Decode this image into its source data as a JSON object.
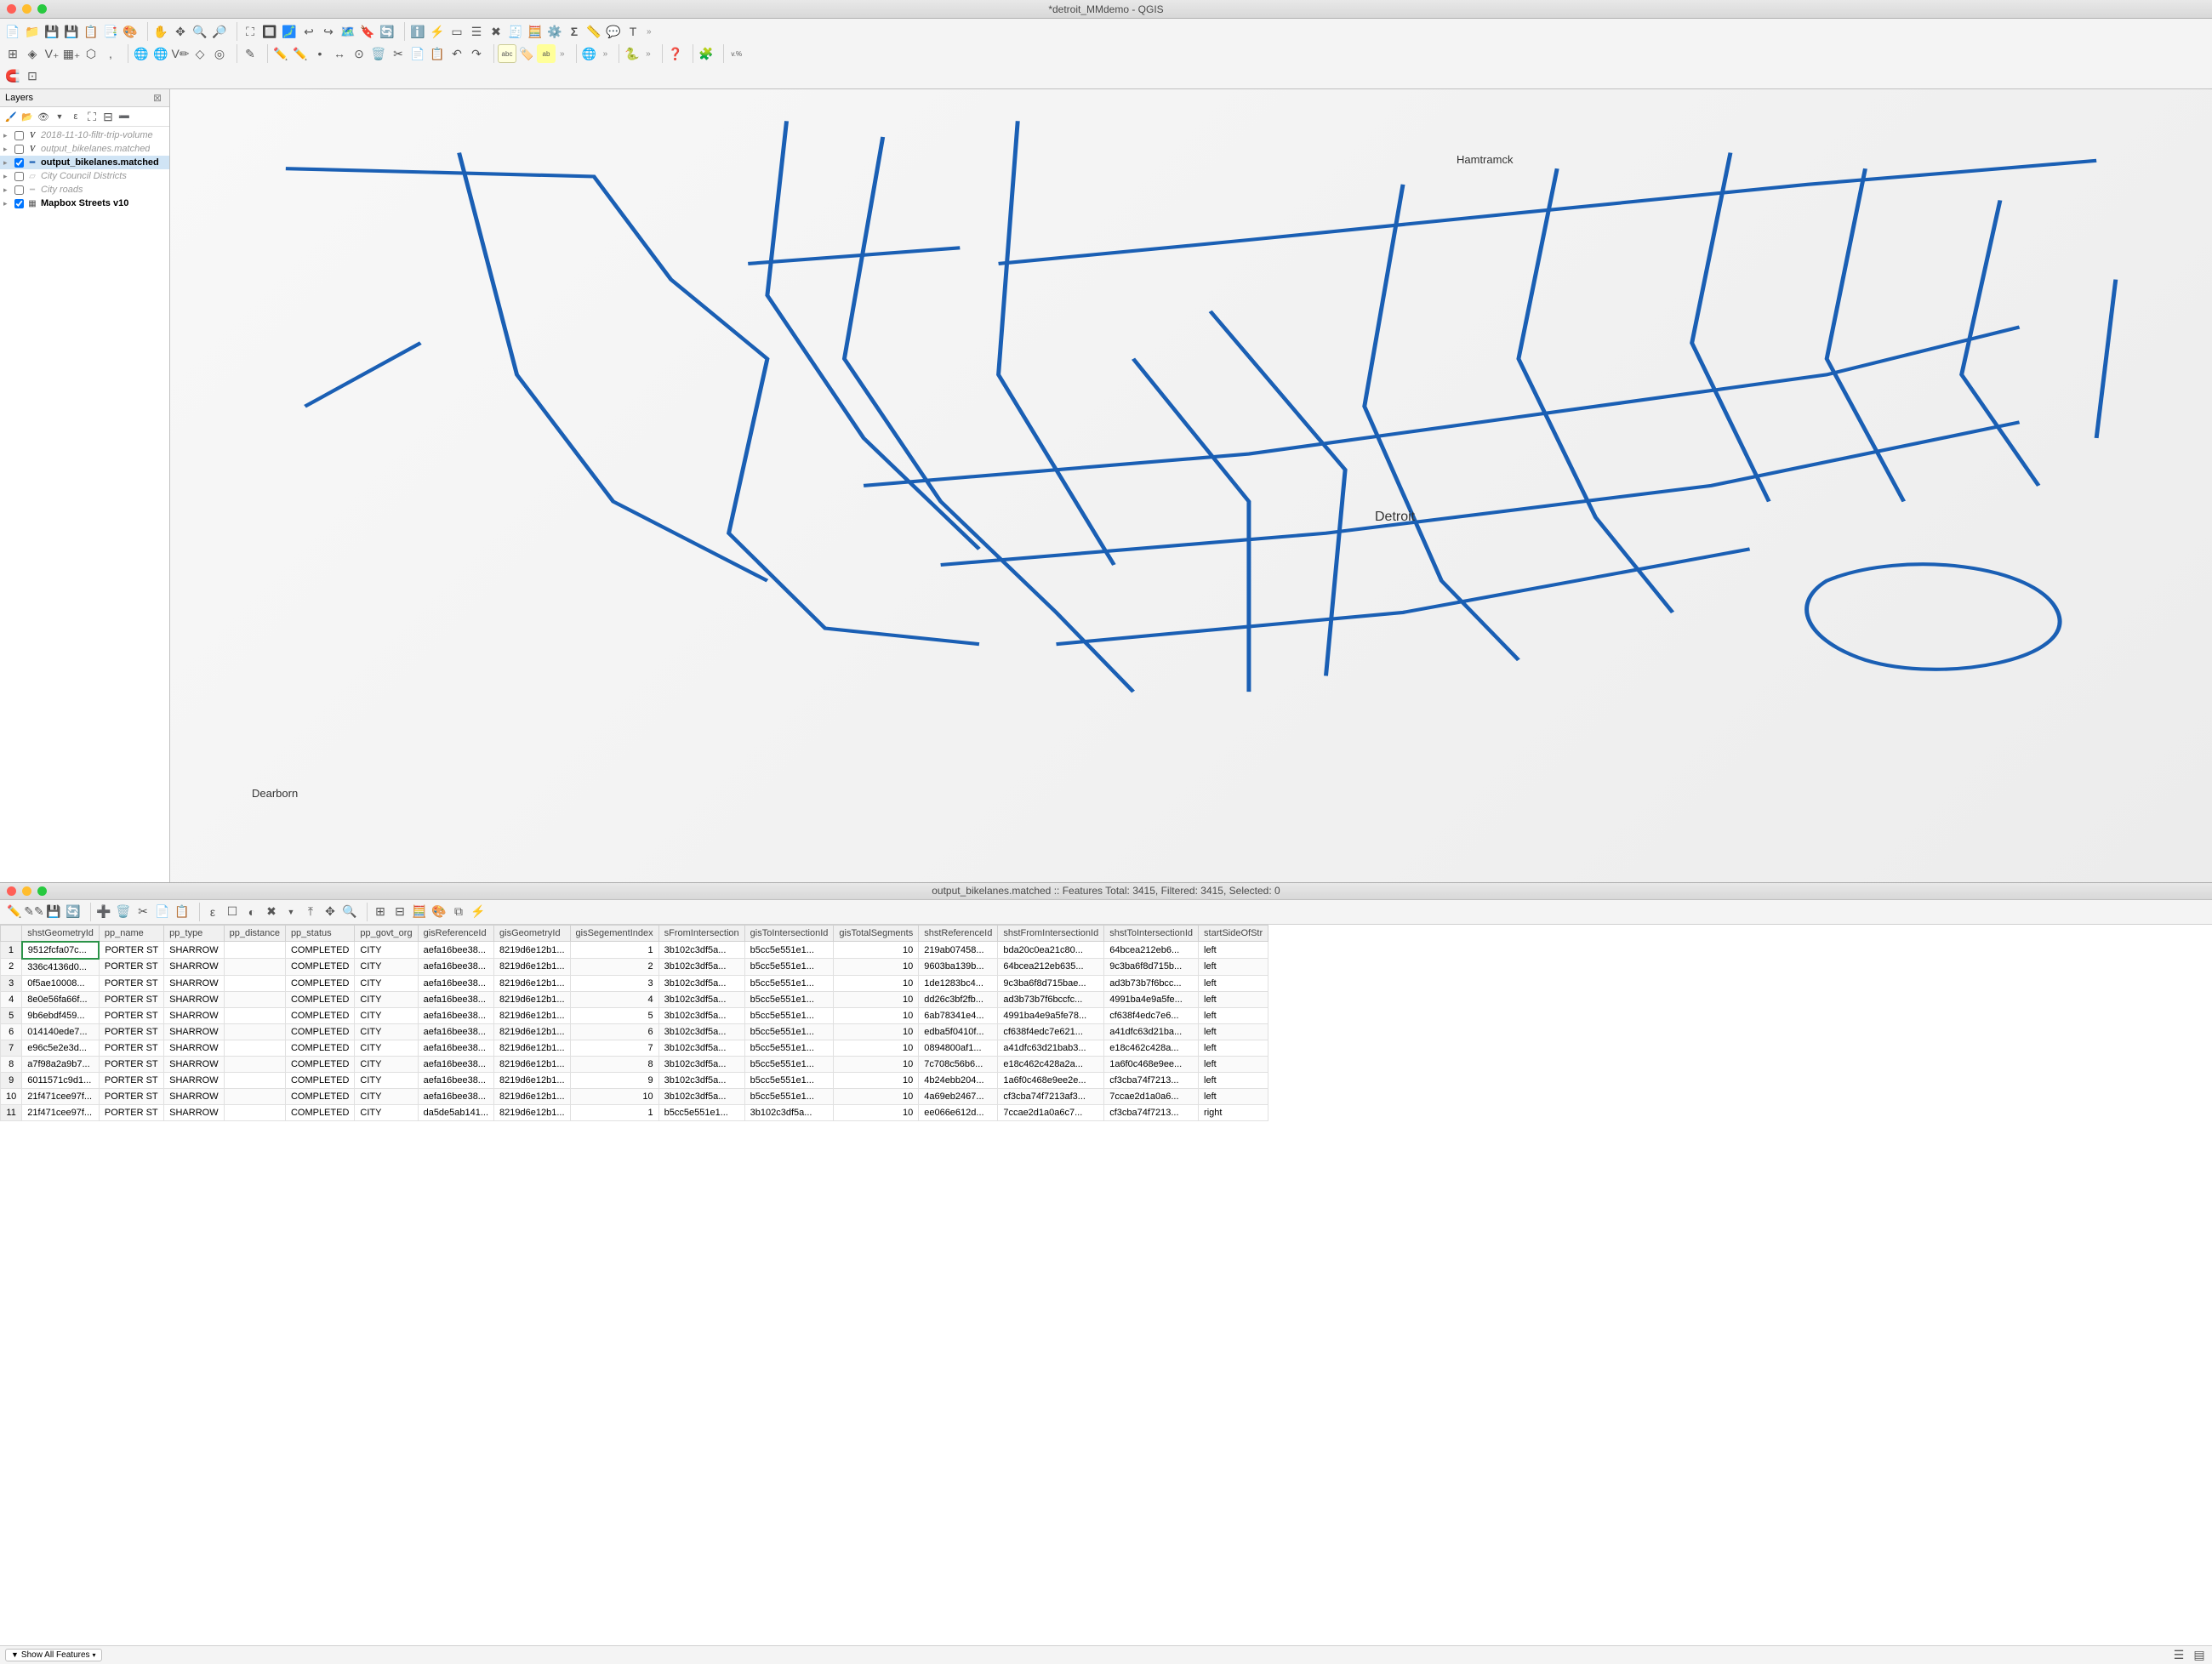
{
  "window": {
    "title": "*detroit_MMdemo - QGIS"
  },
  "layers_panel": {
    "title": "Layers",
    "items": [
      {
        "checked": false,
        "icon": "i-v",
        "name": "2018-11-10-filtr-trip-volume",
        "class": "italic"
      },
      {
        "checked": false,
        "icon": "i-v",
        "name": "output_bikelanes.matched",
        "class": "italic"
      },
      {
        "checked": true,
        "icon": "i-bike",
        "name": "output_bikelanes.matched",
        "class": "bold",
        "selected": true
      },
      {
        "checked": false,
        "icon": "i-poly",
        "name": "City Council Districts",
        "class": "italic"
      },
      {
        "checked": false,
        "icon": "i-line",
        "name": "City roads",
        "class": "italic"
      },
      {
        "checked": true,
        "icon": "i-tiles",
        "name": "Mapbox Streets v10",
        "class": "bold"
      }
    ]
  },
  "map": {
    "city_label": "Detroit",
    "other_labels": [
      "Hamtramck",
      "Dearborn"
    ]
  },
  "attr_table": {
    "title_parts": {
      "layer": "output_bikelanes.matched",
      "total_label": "Features Total:",
      "total": "3415",
      "filtered_label": "Filtered:",
      "filtered": "3415",
      "selected_label": "Selected:",
      "selected": "0"
    },
    "columns": [
      "shstGeometryId",
      "pp_name",
      "pp_type",
      "pp_distance",
      "pp_status",
      "pp_govt_org",
      "gisReferenceId",
      "gisGeometryId",
      "gisSegementIndex",
      "sFromIntersection",
      "gisToIntersectionId",
      "gisTotalSegments",
      "shstReferenceId",
      "shstFromIntersectionId",
      "shstToIntersectionId",
      "startSideOfStr"
    ],
    "rows": [
      [
        "9512fcfa07c...",
        "PORTER ST",
        "SHARROW",
        "",
        "COMPLETED",
        "CITY",
        "aefa16bee38...",
        "8219d6e12b1...",
        "1",
        "3b102c3df5a...",
        "b5cc5e551e1...",
        "10",
        "219ab07458...",
        "bda20c0ea21c80...",
        "64bcea212eb6...",
        "left"
      ],
      [
        "336c4136d0...",
        "PORTER ST",
        "SHARROW",
        "",
        "COMPLETED",
        "CITY",
        "aefa16bee38...",
        "8219d6e12b1...",
        "2",
        "3b102c3df5a...",
        "b5cc5e551e1...",
        "10",
        "9603ba139b...",
        "64bcea212eb635...",
        "9c3ba6f8d715b...",
        "left"
      ],
      [
        "0f5ae10008...",
        "PORTER ST",
        "SHARROW",
        "",
        "COMPLETED",
        "CITY",
        "aefa16bee38...",
        "8219d6e12b1...",
        "3",
        "3b102c3df5a...",
        "b5cc5e551e1...",
        "10",
        "1de1283bc4...",
        "9c3ba6f8d715bae...",
        "ad3b73b7f6bcc...",
        "left"
      ],
      [
        "8e0e56fa66f...",
        "PORTER ST",
        "SHARROW",
        "",
        "COMPLETED",
        "CITY",
        "aefa16bee38...",
        "8219d6e12b1...",
        "4",
        "3b102c3df5a...",
        "b5cc5e551e1...",
        "10",
        "dd26c3bf2fb...",
        "ad3b73b7f6bccfc...",
        "4991ba4e9a5fe...",
        "left"
      ],
      [
        "9b6ebdf459...",
        "PORTER ST",
        "SHARROW",
        "",
        "COMPLETED",
        "CITY",
        "aefa16bee38...",
        "8219d6e12b1...",
        "5",
        "3b102c3df5a...",
        "b5cc5e551e1...",
        "10",
        "6ab78341e4...",
        "4991ba4e9a5fe78...",
        "cf638f4edc7e6...",
        "left"
      ],
      [
        "014140ede7...",
        "PORTER ST",
        "SHARROW",
        "",
        "COMPLETED",
        "CITY",
        "aefa16bee38...",
        "8219d6e12b1...",
        "6",
        "3b102c3df5a...",
        "b5cc5e551e1...",
        "10",
        "edba5f0410f...",
        "cf638f4edc7e621...",
        "a41dfc63d21ba...",
        "left"
      ],
      [
        "e96c5e2e3d...",
        "PORTER ST",
        "SHARROW",
        "",
        "COMPLETED",
        "CITY",
        "aefa16bee38...",
        "8219d6e12b1...",
        "7",
        "3b102c3df5a...",
        "b5cc5e551e1...",
        "10",
        "0894800af1...",
        "a41dfc63d21bab3...",
        "e18c462c428a...",
        "left"
      ],
      [
        "a7f98a2a9b7...",
        "PORTER ST",
        "SHARROW",
        "",
        "COMPLETED",
        "CITY",
        "aefa16bee38...",
        "8219d6e12b1...",
        "8",
        "3b102c3df5a...",
        "b5cc5e551e1...",
        "10",
        "7c708c56b6...",
        "e18c462c428a2a...",
        "1a6f0c468e9ee...",
        "left"
      ],
      [
        "6011571c9d1...",
        "PORTER ST",
        "SHARROW",
        "",
        "COMPLETED",
        "CITY",
        "aefa16bee38...",
        "8219d6e12b1...",
        "9",
        "3b102c3df5a...",
        "b5cc5e551e1...",
        "10",
        "4b24ebb204...",
        "1a6f0c468e9ee2e...",
        "cf3cba74f7213...",
        "left"
      ],
      [
        "21f471cee97f...",
        "PORTER ST",
        "SHARROW",
        "",
        "COMPLETED",
        "CITY",
        "aefa16bee38...",
        "8219d6e12b1...",
        "10",
        "3b102c3df5a...",
        "b5cc5e551e1...",
        "10",
        "4a69eb2467...",
        "cf3cba74f7213af3...",
        "7ccae2d1a0a6...",
        "left"
      ],
      [
        "21f471cee97f...",
        "PORTER ST",
        "SHARROW",
        "",
        "COMPLETED",
        "CITY",
        "da5de5ab141...",
        "8219d6e12b1...",
        "1",
        "b5cc5e551e1...",
        "3b102c3df5a...",
        "10",
        "ee066e612d...",
        "7ccae2d1a0a6c7...",
        "cf3cba74f7213...",
        "right"
      ]
    ]
  },
  "status": {
    "show_all": "Show All Features"
  },
  "colors": {
    "accent": "#1a5fb4",
    "selection": "#2b9348"
  }
}
